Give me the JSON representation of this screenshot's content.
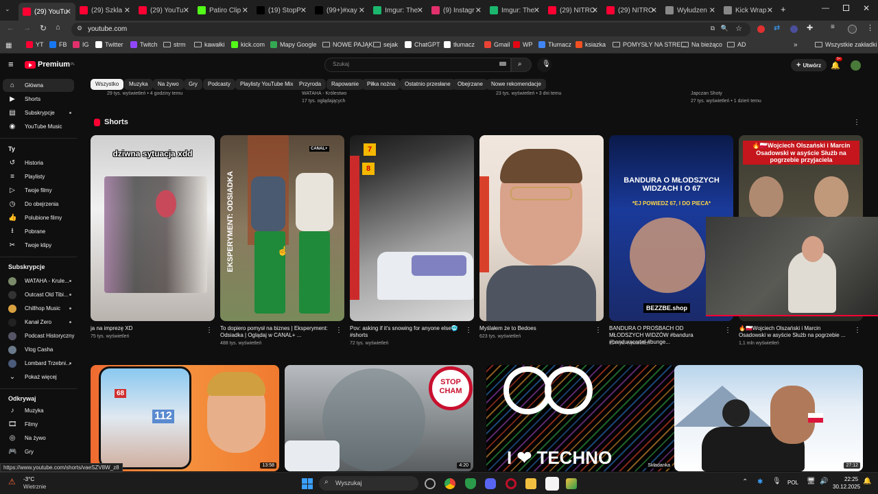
{
  "tabs": [
    {
      "label": "(29) YouTu",
      "color": "#ff0033",
      "active": true
    },
    {
      "label": "(29) Szkla",
      "color": "#ff0033"
    },
    {
      "label": "(29) YouTu",
      "color": "#ff0033"
    },
    {
      "label": "Patiro Clip",
      "color": "#53fc18"
    },
    {
      "label": "(19) StopP",
      "color": "#000000"
    },
    {
      "label": "(99+)#xay",
      "color": "#000000"
    },
    {
      "label": "Imgur: The",
      "color": "#1bb76e"
    },
    {
      "label": "(9) Instagr",
      "color": "#e1306c"
    },
    {
      "label": "Imgur: The",
      "color": "#1bb76e"
    },
    {
      "label": "(29) NITRO",
      "color": "#ff0033"
    },
    {
      "label": "(29) NITRO",
      "color": "#ff0033"
    },
    {
      "label": "Wyłudzen",
      "color": "#888888"
    },
    {
      "label": "Kick Wrap",
      "color": "#888888"
    }
  ],
  "address": {
    "url": "youtube.com"
  },
  "bookmarks": [
    {
      "label": "YT",
      "icon": "youtube-icon",
      "color": "#ff0033"
    },
    {
      "label": "FB",
      "icon": "facebook-icon",
      "color": "#1877f2"
    },
    {
      "label": "IG",
      "icon": "instagram-icon",
      "color": "#e1306c"
    },
    {
      "label": "Twitter",
      "icon": "x-icon",
      "color": "#ffffff"
    },
    {
      "label": "Twitch",
      "icon": "twitch-icon",
      "color": "#9146ff"
    },
    {
      "label": "strm",
      "icon": "folder-icon"
    },
    {
      "label": "kawałki",
      "icon": "folder-icon"
    },
    {
      "label": "kick.com",
      "icon": "kick-icon",
      "color": "#53fc18"
    },
    {
      "label": "Mapy Google",
      "icon": "maps-icon",
      "color": "#34a853"
    },
    {
      "label": "NOWE PAJĄKI",
      "icon": "folder-icon"
    },
    {
      "label": "sejak",
      "icon": "folder-icon"
    },
    {
      "label": "ChatGPT",
      "icon": "chatgpt-icon",
      "color": "#ffffff"
    },
    {
      "label": "tłumacz",
      "icon": "translate-icon",
      "color": "#ffffff"
    },
    {
      "label": "Gmail",
      "icon": "gmail-icon",
      "color": "#ea4335"
    },
    {
      "label": "WP",
      "icon": "wp-icon",
      "color": "#e30613"
    },
    {
      "label": "Tłumacz",
      "icon": "translate-icon",
      "color": "#4285f4"
    },
    {
      "label": "ksiazka",
      "icon": "microsoft-icon",
      "color": "#f25022"
    },
    {
      "label": "POMYSŁY NA STRE...",
      "icon": "folder-icon"
    },
    {
      "label": "Na bieżąco",
      "icon": "folder-icon"
    },
    {
      "label": "AD",
      "icon": "folder-icon"
    },
    {
      "label": "Wszystkie zakładki",
      "icon": "folder-icon"
    }
  ],
  "header": {
    "logo": "Premium",
    "logo_country": "PL",
    "search_placeholder": "Szukaj",
    "create_label": "Utwórz",
    "notif_count": "9+"
  },
  "chips": [
    "Wszystko",
    "Muzyka",
    "Na żywo",
    "Gry",
    "Podcasty",
    "Playlisty YouTube Mix",
    "Przyroda",
    "Rapowanie",
    "Piłka nożna",
    "Ostatnio przesłane",
    "Obejrzane",
    "Nowe rekomendacje"
  ],
  "sidebar": {
    "main": [
      {
        "label": "Główna",
        "icon": "home-icon",
        "active": true
      },
      {
        "label": "Shorts",
        "icon": "shorts-icon"
      },
      {
        "label": "Subskrypcje",
        "icon": "subscriptions-icon"
      },
      {
        "label": "YouTube Music",
        "icon": "music-icon"
      }
    ],
    "you_header": "Ty",
    "you": [
      {
        "label": "Historia",
        "icon": "history-icon"
      },
      {
        "label": "Playlisty",
        "icon": "playlist-icon"
      },
      {
        "label": "Twoje filmy",
        "icon": "video-icon"
      },
      {
        "label": "Do obejrzenia",
        "icon": "clock-icon"
      },
      {
        "label": "Polubione filmy",
        "icon": "like-icon"
      },
      {
        "label": "Pobrane",
        "icon": "download-icon"
      },
      {
        "label": "Twoje klipy",
        "icon": "scissors-icon"
      }
    ],
    "subs_header": "Subskrypcje",
    "subs": [
      {
        "label": "WATAHA - Krule...",
        "color": "#7a8a6a"
      },
      {
        "label": "Outcast Old Tibi...",
        "color": "#333333"
      },
      {
        "label": "Chillhop Music",
        "color": "#d8a040"
      },
      {
        "label": "Kanał Zero",
        "color": "#222222"
      },
      {
        "label": "Podcast Historyczny",
        "color": "#555566"
      },
      {
        "label": "Vlog Casha",
        "color": "#6a7a8a"
      },
      {
        "label": "Lombard Trzebni...",
        "color": "#4a5a7a"
      }
    ],
    "more_label": "Pokaż więcej",
    "explore_header": "Odkrywaj",
    "explore": [
      {
        "label": "Muzyka",
        "icon": "music-note-icon"
      },
      {
        "label": "Filmy",
        "icon": "film-icon"
      },
      {
        "label": "Na żywo",
        "icon": "live-icon"
      },
      {
        "label": "Gry",
        "icon": "gamepad-icon"
      }
    ]
  },
  "top_partial": [
    {
      "meta": "29 tys. wyświetleń • 4 godziny temu"
    },
    {
      "meta": "WATAHA - Królestwo",
      "meta2": "17 tys. oglądających"
    },
    {
      "meta": "23 tys. wyświetleń • 3 dni temu"
    },
    {
      "meta": "Japczan Shoty",
      "meta2": "27 tys. wyświetleń • 1 dzień temu"
    }
  ],
  "shorts_section": {
    "title": "Shorts"
  },
  "shorts": [
    {
      "title": "ja na imprezę XD",
      "views": "75 tys. wyświetleń",
      "overlay": "dziwna sytuacja xdd"
    },
    {
      "title": "To dopiero pomysł na biznes | Eksperyment: Odsiadka | Oglądaj w CANAL+ ...",
      "views": "488 tys. wyświetleń",
      "overlay": "EKSPERYMENT: ODSIADKA",
      "badge": "CANAL+"
    },
    {
      "title": "Pov: asking if it's snowing for anyone else🥶 #shorts",
      "views": "72 tys. wyświetleń"
    },
    {
      "title": "Myślałem że to Bedoes",
      "views": "623 tys. wyświetleń"
    },
    {
      "title": "BANDURA O PROŚBACH OD MŁODSZYCH WIDZÓW #bandura #banduracartel #bunge...",
      "views": "114 tys. wyświetleń",
      "overlay": "BANDURA O MŁODSZYCH WIDZACH I O 67",
      "overlay2": "*EJ POWIEDZ 67, I DO PIECA*",
      "overlay3": "BEZZBE.shop"
    },
    {
      "title": "🔥🇵🇱Wojciech Olszański i Marcin Osadowski w asyście Służb na pogrzebie ...",
      "views": "1,1 mln wyświetleń",
      "overlay": "🔥🇵🇱Wojciech Olszański i Marcin Osadowski w asyście Służb na pogrzebie przyjaciela"
    }
  ],
  "videos": [
    {
      "duration": "13:58",
      "overlay1": "68",
      "overlay2": "112"
    },
    {
      "duration": "4:20",
      "overlay": "STOP CHAM"
    },
    {
      "badge": "Składanka",
      "overlay": "I ❤ TECHNO"
    },
    {
      "duration": "27:12"
    }
  ],
  "status_url": "https://www.youtube.com/shorts/vaeSZV8W_z8",
  "taskbar": {
    "weather_temp": "-3°C",
    "weather_desc": "Wietrznie",
    "search_placeholder": "Wyszukaj",
    "lang": "POL",
    "time": "22:25",
    "date": "30.12.2025"
  }
}
